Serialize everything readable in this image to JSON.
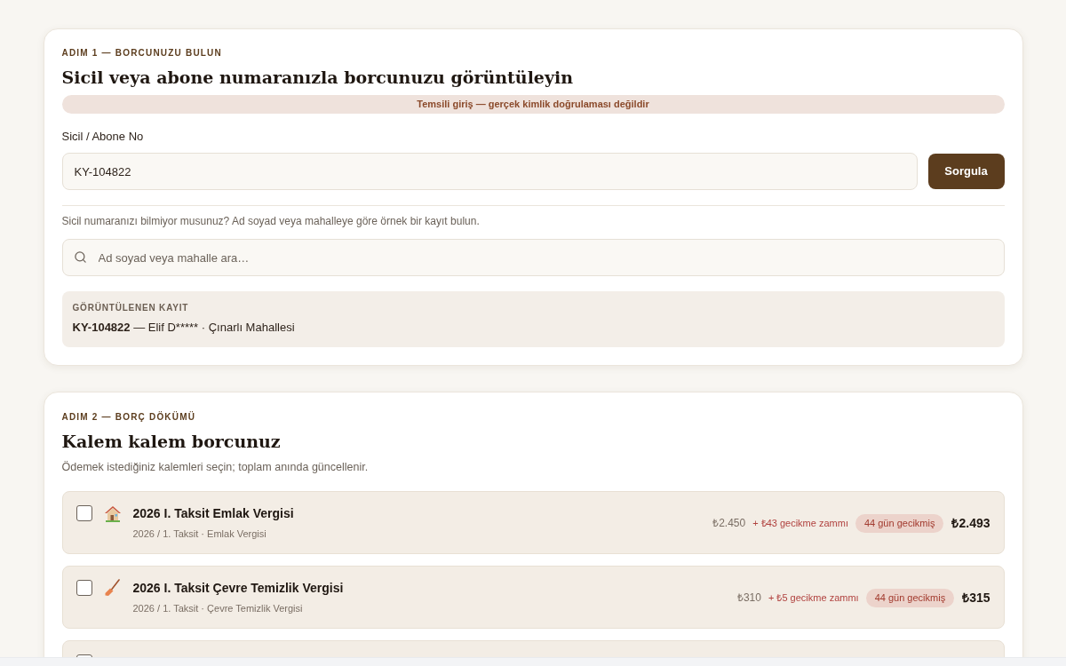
{
  "lookup": {
    "eyebrow": "ADIM 1 — BORCUNUZU BULUN",
    "title": "Sicil veya abone numaranızla borcunuzu görüntüleyin",
    "notice": "Temsili giriş — gerçek kimlik doğrulaması değildir",
    "field": {
      "label": "Sicil / Abone No",
      "value": "KY-104822"
    },
    "button": "Sorgula",
    "helper": "Sicil numaranızı bilmiyor musunuz? Ad soyad veya mahalleye göre örnek bir kayıt bulun.",
    "search": {
      "placeholder": "Ad soyad veya mahalle ara…"
    },
    "record": {
      "label": "GÖRÜNTÜLENEN KAYIT",
      "id": "KY-104822",
      "text": "— Elif D***** · Çınarlı Mahallesi"
    }
  },
  "breakdown": {
    "eyebrow": "ADIM 2 — BORÇ DÖKÜMÜ",
    "title": "Kalem kalem borcunuz",
    "description": "Ödemek istediğiniz kalemleri seçin; toplam anında güncellenir.",
    "items": [
      {
        "kind": "property",
        "checked": false,
        "title": "2026 I. Taksit Emlak Vergisi",
        "subtitle": "2026 / 1. Taksit · Emlak Vergisi",
        "base": "₺2.450",
        "late_fee": "+ ₺43 gecikme zammı",
        "overdue": "44 gün gecikmiş",
        "total": "₺2.493"
      },
      {
        "kind": "cleaning",
        "checked": false,
        "title": "2026 I. Taksit Çevre Temizlik Vergisi",
        "subtitle": "2026 / 1. Taksit · Çevre Temizlik Vergisi",
        "base": "₺310",
        "late_fee": "+ ₺5 gecikme zammı",
        "overdue": "44 gün gecikmiş",
        "total": "₺315"
      },
      {
        "checked": false
      }
    ]
  }
}
